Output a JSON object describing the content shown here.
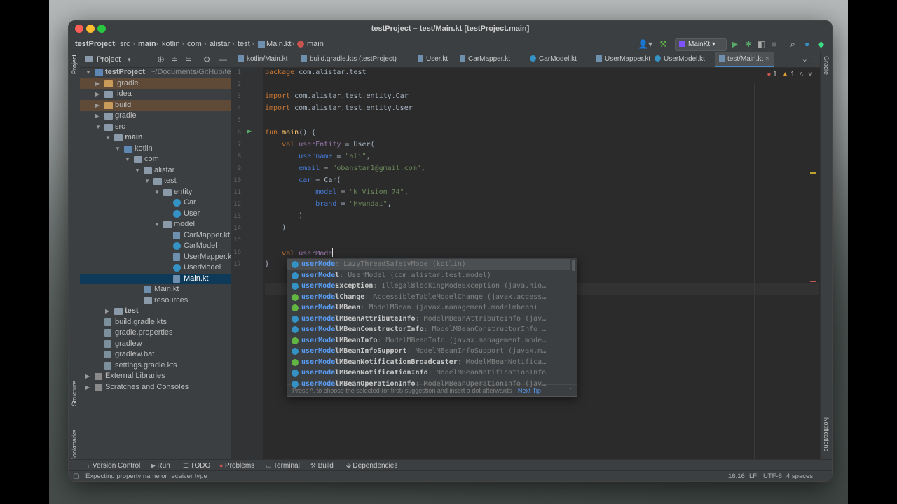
{
  "window": {
    "title": "testProject – test/Main.kt [testProject.main]"
  },
  "breadcrumb": [
    "testProject",
    "src",
    "main",
    "kotlin",
    "com",
    "alistar",
    "test",
    "Main.kt",
    "main"
  ],
  "toolbar": {
    "run_config": "MainKt"
  },
  "project_panel": {
    "title": "Project",
    "tree": [
      {
        "label": "testProject",
        "extra": "~/Documents/GitHub/test",
        "depth": 0,
        "arrow": "open",
        "icon": "folder-b",
        "bold": true
      },
      {
        "label": ".gradle",
        "depth": 1,
        "arrow": "closed",
        "icon": "folder-o",
        "excluded": true
      },
      {
        "label": ".idea",
        "depth": 1,
        "arrow": "closed",
        "icon": "folder"
      },
      {
        "label": "build",
        "depth": 1,
        "arrow": "closed",
        "icon": "folder-o",
        "excluded": true
      },
      {
        "label": "gradle",
        "depth": 1,
        "arrow": "closed",
        "icon": "folder"
      },
      {
        "label": "src",
        "depth": 1,
        "arrow": "open",
        "icon": "folder"
      },
      {
        "label": "main",
        "depth": 2,
        "arrow": "open",
        "icon": "folder",
        "bold": true
      },
      {
        "label": "kotlin",
        "depth": 3,
        "arrow": "open",
        "icon": "folder-b"
      },
      {
        "label": "com",
        "depth": 4,
        "arrow": "open",
        "icon": "folder"
      },
      {
        "label": "alistar",
        "depth": 5,
        "arrow": "open",
        "icon": "folder"
      },
      {
        "label": "test",
        "depth": 6,
        "arrow": "open",
        "icon": "folder"
      },
      {
        "label": "entity",
        "depth": 7,
        "arrow": "open",
        "icon": "folder"
      },
      {
        "label": "Car",
        "depth": 8,
        "arrow": "",
        "icon": "kt"
      },
      {
        "label": "User",
        "depth": 8,
        "arrow": "",
        "icon": "kt"
      },
      {
        "label": "model",
        "depth": 7,
        "arrow": "open",
        "icon": "folder"
      },
      {
        "label": "CarMapper.kt",
        "depth": 8,
        "arrow": "",
        "icon": "kf"
      },
      {
        "label": "CarModel",
        "depth": 8,
        "arrow": "",
        "icon": "kt"
      },
      {
        "label": "UserMapper.kt",
        "depth": 8,
        "arrow": "",
        "icon": "kf"
      },
      {
        "label": "UserModel",
        "depth": 8,
        "arrow": "",
        "icon": "kt"
      },
      {
        "label": "Main.kt",
        "depth": 8,
        "arrow": "",
        "icon": "kf",
        "selected": true
      },
      {
        "label": "Main.kt",
        "depth": 5,
        "arrow": "",
        "icon": "kf"
      },
      {
        "label": "resources",
        "depth": 5,
        "arrow": "",
        "icon": "folder"
      },
      {
        "label": "test",
        "depth": 2,
        "arrow": "closed",
        "icon": "folder",
        "bold": true
      },
      {
        "label": "build.gradle.kts",
        "depth": 1,
        "arrow": "",
        "icon": "gr"
      },
      {
        "label": "gradle.properties",
        "depth": 1,
        "arrow": "",
        "icon": "gr"
      },
      {
        "label": "gradlew",
        "depth": 1,
        "arrow": "",
        "icon": "gr"
      },
      {
        "label": "gradlew.bat",
        "depth": 1,
        "arrow": "",
        "icon": "gr"
      },
      {
        "label": "settings.gradle.kts",
        "depth": 1,
        "arrow": "",
        "icon": "gr"
      },
      {
        "label": "External Libraries",
        "depth": 0,
        "arrow": "closed",
        "icon": "lib"
      },
      {
        "label": "Scratches and Consoles",
        "depth": 0,
        "arrow": "closed",
        "icon": "lib"
      }
    ]
  },
  "tabs": [
    {
      "label": "kotlin/Main.kt",
      "kind": "file"
    },
    {
      "label": "build.gradle.kts (testProject)",
      "kind": "file"
    },
    {
      "label": "User.kt",
      "kind": "file"
    },
    {
      "label": "CarMapper.kt",
      "kind": "file"
    },
    {
      "label": "CarModel.kt",
      "kind": "class"
    },
    {
      "label": "UserMapper.kt",
      "kind": "file"
    },
    {
      "label": "UserModel.kt",
      "kind": "class"
    },
    {
      "label": "test/Main.kt",
      "kind": "file",
      "active": true
    }
  ],
  "inspections": {
    "errors": "1",
    "warnings": "1"
  },
  "editor": {
    "lines": [
      [
        [
          "kw",
          "package "
        ],
        [
          "",
          "com.alistar.test"
        ]
      ],
      [],
      [
        [
          "kw",
          "import "
        ],
        [
          "",
          "com.alistar.test.entity.Car"
        ]
      ],
      [
        [
          "kw",
          "import "
        ],
        [
          "",
          "com.alistar.test.entity.User"
        ]
      ],
      [],
      [
        [
          "kw",
          "fun "
        ],
        [
          "fn",
          "main"
        ],
        [
          "",
          "() {"
        ]
      ],
      [
        [
          "",
          "    "
        ],
        [
          "kw",
          "val "
        ],
        [
          "var",
          "userEntity"
        ],
        [
          "",
          " = User("
        ]
      ],
      [
        [
          "",
          "        "
        ],
        [
          "par",
          "username"
        ],
        [
          "",
          " = "
        ],
        [
          "str",
          "\"ali\""
        ],
        [
          "",
          ","
        ]
      ],
      [
        [
          "",
          "        "
        ],
        [
          "par",
          "email"
        ],
        [
          "",
          " = "
        ],
        [
          "str",
          "\"obanstar1@gmail.com\""
        ],
        [
          "",
          ","
        ]
      ],
      [
        [
          "",
          "        "
        ],
        [
          "par",
          "car"
        ],
        [
          "",
          " = Car("
        ]
      ],
      [
        [
          "",
          "            "
        ],
        [
          "par",
          "model"
        ],
        [
          "",
          " = "
        ],
        [
          "str",
          "\"N Vision 74\""
        ],
        [
          "",
          ","
        ]
      ],
      [
        [
          "",
          "            "
        ],
        [
          "par",
          "brand"
        ],
        [
          "",
          " = "
        ],
        [
          "str",
          "\"Hyundai\""
        ],
        [
          "",
          ","
        ]
      ],
      [
        [
          "",
          "        )"
        ]
      ],
      [
        [
          "",
          "    )"
        ]
      ],
      [],
      [
        [
          "",
          "    "
        ],
        [
          "kw",
          "val "
        ],
        [
          "var",
          "userMode"
        ]
      ],
      [
        [
          "",
          "}"
        ]
      ]
    ]
  },
  "completion": {
    "items": [
      {
        "match": "userMode",
        "rest": "",
        "type": ": LazyThreadSafetyMode (kotlin)",
        "icon": "#3592c4",
        "selected": true
      },
      {
        "match": "userMode",
        "rest": "l",
        "type": ": UserModel (com.alistar.test.model)",
        "icon": "#3592c4"
      },
      {
        "match": "userMode",
        "rest": "Exception",
        "type": ": IllegalBlockingModeException (java.nio…",
        "icon": "#3592c4"
      },
      {
        "match": "userMode",
        "rest": "lChange",
        "type": ": AccessibleTableModelChange (javax.access…",
        "icon": "#62b543"
      },
      {
        "match": "userMode",
        "rest": "lMBean",
        "type": ": ModelMBean (javax.management.modelmbean)",
        "icon": "#62b543"
      },
      {
        "match": "userMode",
        "rest": "lMBeanAttributeInfo",
        "type": ": ModelMBeanAttributeInfo (jav…",
        "icon": "#3592c4"
      },
      {
        "match": "userMode",
        "rest": "lMBeanConstructorInfo",
        "type": ": ModelMBeanConstructorInfo …",
        "icon": "#3592c4"
      },
      {
        "match": "userMode",
        "rest": "lMBeanInfo",
        "type": ": ModelMBeanInfo (javax.management.mode…",
        "icon": "#62b543"
      },
      {
        "match": "userMode",
        "rest": "lMBeanInfoSupport",
        "type": ": ModelMBeanInfoSupport (javax.m…",
        "icon": "#3592c4"
      },
      {
        "match": "userMode",
        "rest": "lMBeanNotificationBroadcaster",
        "type": ": ModelMBeanNotifica…",
        "icon": "#62b543"
      },
      {
        "match": "userMode",
        "rest": "lMBeanNotificationInfo",
        "type": ": ModelMBeanNotificationInfo",
        "icon": "#3592c4"
      },
      {
        "match": "userMode",
        "rest": "lMBeanOperationInfo",
        "type": ": ModelMBeanOperationInfo (jav…",
        "icon": "#3592c4"
      }
    ],
    "footer": "Press ^. to choose the selected (or first) suggestion and insert a dot afterwards",
    "next_tip": "Next Tip"
  },
  "bottom_tools": [
    "Version Control",
    "Run",
    "TODO",
    "Problems",
    "Terminal",
    "Build",
    "Dependencies"
  ],
  "status": {
    "message": "Expecting property name or receiver type",
    "position": "16:16",
    "line_sep": "LF",
    "encoding": "UTF-8",
    "indent": "4 spaces"
  },
  "side_labels": {
    "project": "Project",
    "structure": "Structure",
    "bookmarks": "Bookmarks",
    "gradle": "Gradle",
    "notifications": "Notifications"
  },
  "colors": {
    "accent": "#4a88c7",
    "selection": "#0d3a58",
    "excluded": "#5e4a37"
  }
}
